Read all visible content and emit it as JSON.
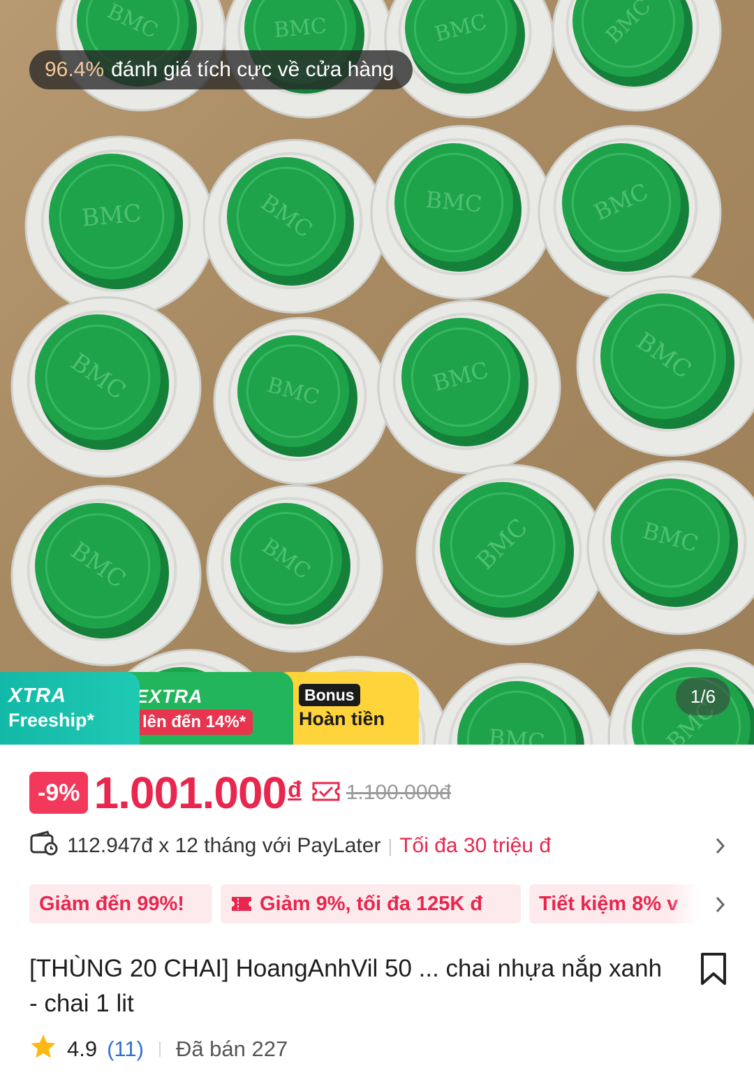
{
  "hero": {
    "rating_pct": "96.4%",
    "rating_text": "đánh giá tích cực về cửa hàng",
    "image_counter": "1/6",
    "cap_logo_text": "BMC"
  },
  "promo": {
    "freeship_line1": "XTRA",
    "freeship_line2": "Freeship*",
    "extra_line1": "EXTRA",
    "extra_line2": "lên đến 14%*",
    "bonus_line1": "Bonus",
    "bonus_line2": "Hoàn tiền"
  },
  "price": {
    "discount": "-9%",
    "current": "1.001.000",
    "currency": "đ",
    "original": "1.100.000đ"
  },
  "paylater": {
    "text": "112.947đ x 12 tháng với PayLater",
    "max": "Tối đa 30 triệu đ"
  },
  "vouchers": [
    {
      "label": "Giảm đến 99%!"
    },
    {
      "label": "Giảm 9%, tối đa 125K đ"
    },
    {
      "label": "Tiết kiệm 8% v"
    }
  ],
  "product": {
    "title": "[THÙNG 20 CHAI] HoangAnhVil  50 ... chai nhựa nắp xanh - chai 1 lit"
  },
  "rating": {
    "score": "4.9",
    "count": "(11)",
    "sold": "Đã bán 227"
  },
  "colors": {
    "accent": "#e8264e",
    "cap_green": "#1fa34a",
    "freeship": "#13b9a8",
    "extra": "#22b55c",
    "bonus": "#ffd33a"
  }
}
